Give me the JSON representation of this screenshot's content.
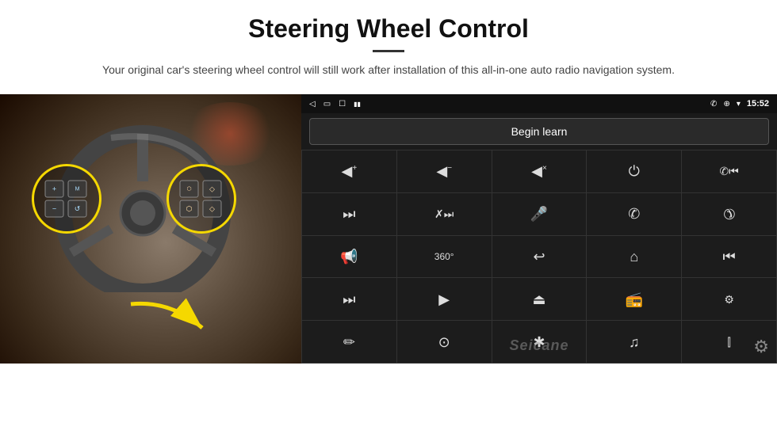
{
  "header": {
    "title": "Steering Wheel Control",
    "divider": true,
    "subtitle": "Your original car's steering wheel control will still work after installation of this all-in-one auto radio navigation system."
  },
  "android_screen": {
    "status_bar": {
      "back_icon": "◁",
      "window_icon": "▭",
      "square_icon": "☐",
      "battery_icon": "▮▮",
      "phone_icon": "✆",
      "location_icon": "⊕",
      "wifi_icon": "▾",
      "time": "15:52"
    },
    "begin_learn_label": "Begin learn",
    "grid_rows": [
      [
        "🔊+",
        "🔊−",
        "🔇",
        "⏻",
        "📞⏮"
      ],
      [
        "⏭",
        "🔇⏭",
        "🎤",
        "📞",
        "📞↩"
      ],
      [
        "📢",
        "360°",
        "↩",
        "🏠",
        "⏮⏮"
      ],
      [
        "⏭⏭",
        "➤",
        "⏏",
        "📻",
        "⚙"
      ],
      [
        "✏",
        "⊙",
        "✱",
        "♫",
        "📊"
      ]
    ],
    "watermark": "Seicane",
    "gear_icon": "⚙"
  },
  "icons": {
    "vol_up": "◀+",
    "vol_down": "◀−",
    "mute": "◀×",
    "power": "⏻",
    "phone_prev": "✆⏮",
    "next_track": "⏭",
    "mute_next": "✗⏭",
    "mic": "🎤",
    "phone": "✆",
    "hang_up": "✆↩",
    "speaker": "📢",
    "camera_360": "360",
    "back": "↩",
    "home": "⌂",
    "prev_prev": "⏮",
    "fast_fwd": "⏭",
    "nav": "▶",
    "eject": "⏏",
    "radio": "📻",
    "eq": "⚙",
    "pen": "✏",
    "settings_circle": "⊙",
    "bluetooth": "✱",
    "music": "♫",
    "levels": "📊"
  }
}
